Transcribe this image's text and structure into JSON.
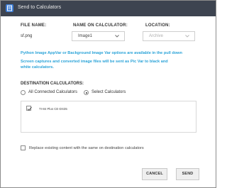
{
  "window": {
    "title": "Send to Calculators"
  },
  "headers": {
    "file_name": "FILE NAME:",
    "name_on_calc": "NAME ON CALCULATOR:",
    "location": "LOCATION:"
  },
  "file": {
    "name": "sf.png",
    "calculator_name": "Image1",
    "location": "Archive"
  },
  "info": {
    "line1": "Python Image AppVar or Background Image Var options are available in the pull down",
    "line2": "Screen captures and converted image files will be sent as Pic Var to black and",
    "line3": "white calculators."
  },
  "destination": {
    "label": "DESTINATION CALCULATORS:",
    "options": [
      "All Connected Calculators",
      "Select Calculators"
    ],
    "selected": "Select Calculators",
    "calculators": [
      {
        "name": "TI-84 Plus CE-DS35",
        "checked": true
      }
    ]
  },
  "replace": {
    "label": "Replace existing content with the same on destination calculators",
    "checked": false
  },
  "buttons": {
    "cancel": "CANCEL",
    "send": "SEND"
  },
  "colors": {
    "titlebar": "#3d4450",
    "info_text": "#2aa3d8",
    "app_icon": "#3a7bd5"
  }
}
